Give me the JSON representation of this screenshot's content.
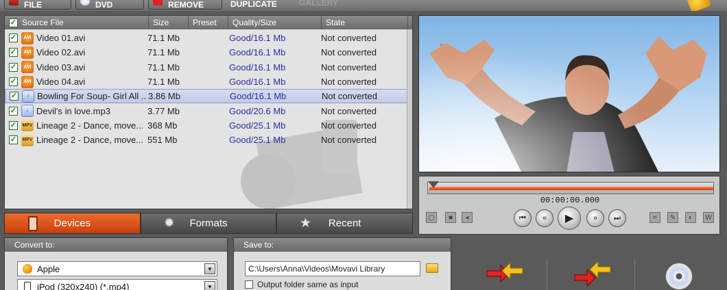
{
  "toolbar": {
    "buttons": [
      "FILE",
      "DVD",
      "REMOVE",
      "DUPLICATE"
    ],
    "gallery_label": "GALLERY"
  },
  "file_list": {
    "columns": [
      "Source File",
      "Size",
      "Preset",
      "Quality/Size",
      "State"
    ],
    "rows": [
      {
        "icon": "avi-file-icon",
        "name": "Video 01.avi",
        "size": "71.1 Mb",
        "preset": "",
        "quality": "Good/16.1 Mb",
        "state": "Not converted",
        "selected": false
      },
      {
        "icon": "avi-file-icon",
        "name": "Video 02.avi",
        "size": "71.1 Mb",
        "preset": "",
        "quality": "Good/16.1 Mb",
        "state": "Not converted",
        "selected": false
      },
      {
        "icon": "avi-file-icon",
        "name": "Video 03.avi",
        "size": "71.1 Mb",
        "preset": "",
        "quality": "Good/16.1 Mb",
        "state": "Not converted",
        "selected": false
      },
      {
        "icon": "avi-file-icon",
        "name": "Video 04.avi",
        "size": "71.1 Mb",
        "preset": "",
        "quality": "Good/16.1 Mb",
        "state": "Not converted",
        "selected": false
      },
      {
        "icon": "mp3-file-icon",
        "name": "Bowling For Soup- Girl All ...",
        "size": "3.86 Mb",
        "preset": "",
        "quality": "Good/16.1 Mb",
        "state": "Not converted",
        "selected": true
      },
      {
        "icon": "mp3-file-icon",
        "name": "Devil's in love.mp3",
        "size": "3.77 Mb",
        "preset": "",
        "quality": "Good/20.6 Mb",
        "state": "Not converted",
        "selected": false
      },
      {
        "icon": "mpeg-file-icon",
        "name": "Lineage 2 - Dance, move...",
        "size": "368 Mb",
        "preset": "",
        "quality": "Good/25.1 Mb",
        "state": "Not converted",
        "selected": false
      },
      {
        "icon": "mpeg-file-icon",
        "name": "Lineage 2 - Dance, move...",
        "size": "551 Mb",
        "preset": "",
        "quality": "Good/25.1 Mb",
        "state": "Not converted",
        "selected": false
      }
    ]
  },
  "tabs": [
    {
      "label": "Devices",
      "icon": "ipod-icon",
      "active": true
    },
    {
      "label": "Formats",
      "icon": "gear-icon",
      "active": false
    },
    {
      "label": "Recent",
      "icon": "star-icon",
      "active": false
    }
  ],
  "convert_to": {
    "title": "Convert to:",
    "brand": "Apple",
    "preset": "iPod (320x240) (*.mp4)"
  },
  "save_to": {
    "title": "Save to:",
    "path": "C:\\Users\\Anna\\Videos\\Movavi Library",
    "same_folder_label": "Output folder same as input"
  },
  "player": {
    "time": "00:00:00.000",
    "position_fraction": 0.0
  },
  "colors": {
    "accent": "#e0561a",
    "quality_text": "#2c2ca8"
  }
}
